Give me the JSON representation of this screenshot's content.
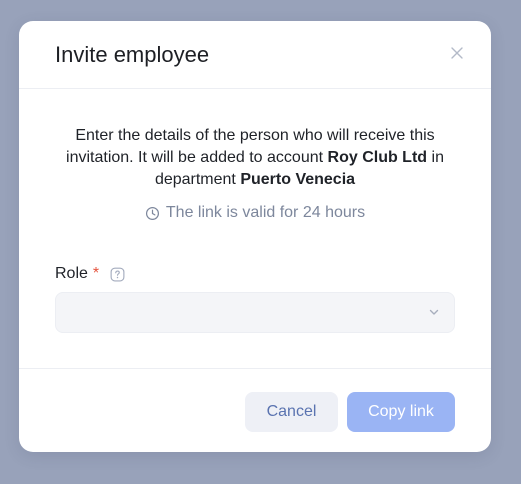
{
  "modal": {
    "title": "Invite employee",
    "description": {
      "part1": "Enter the details of the person who will receive this invitation. It will be added to account ",
      "account": "Roy Club Ltd",
      "part2": " in department ",
      "department": "Puerto Venecia"
    },
    "validity_text": "The link is valid for 24 hours",
    "role_field": {
      "label": "Role",
      "required_mark": "*",
      "value": ""
    },
    "buttons": {
      "cancel": "Cancel",
      "copy_link": "Copy link"
    }
  },
  "icons": {
    "close": "close-icon",
    "clock": "clock-icon",
    "help": "help-icon",
    "chevron": "chevron-down-icon"
  },
  "colors": {
    "backdrop": "#98a2ba",
    "primary_disabled": "#9ab4f4",
    "secondary_bg": "#eef0f6",
    "secondary_text": "#5a73b0",
    "required": "#e5533d",
    "muted_text": "#7d879c"
  }
}
